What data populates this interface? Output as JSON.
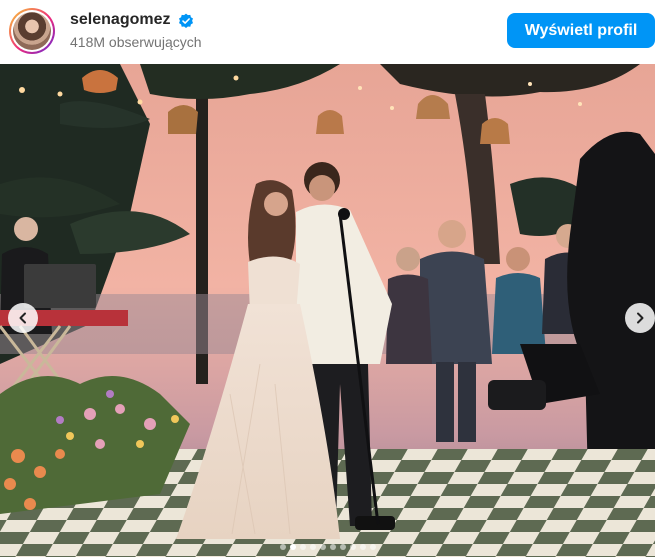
{
  "profile": {
    "username": "selenagomez",
    "verified_icon": "verified-badge-icon",
    "followers": "418M obserwujących",
    "view_profile_label": "Wyświetl profil",
    "accent_color": "#0095f6"
  },
  "carousel": {
    "prev_icon": "chevron-left-icon",
    "next_icon": "chevron-right-icon",
    "slide_count": 10,
    "active_index": 1
  }
}
